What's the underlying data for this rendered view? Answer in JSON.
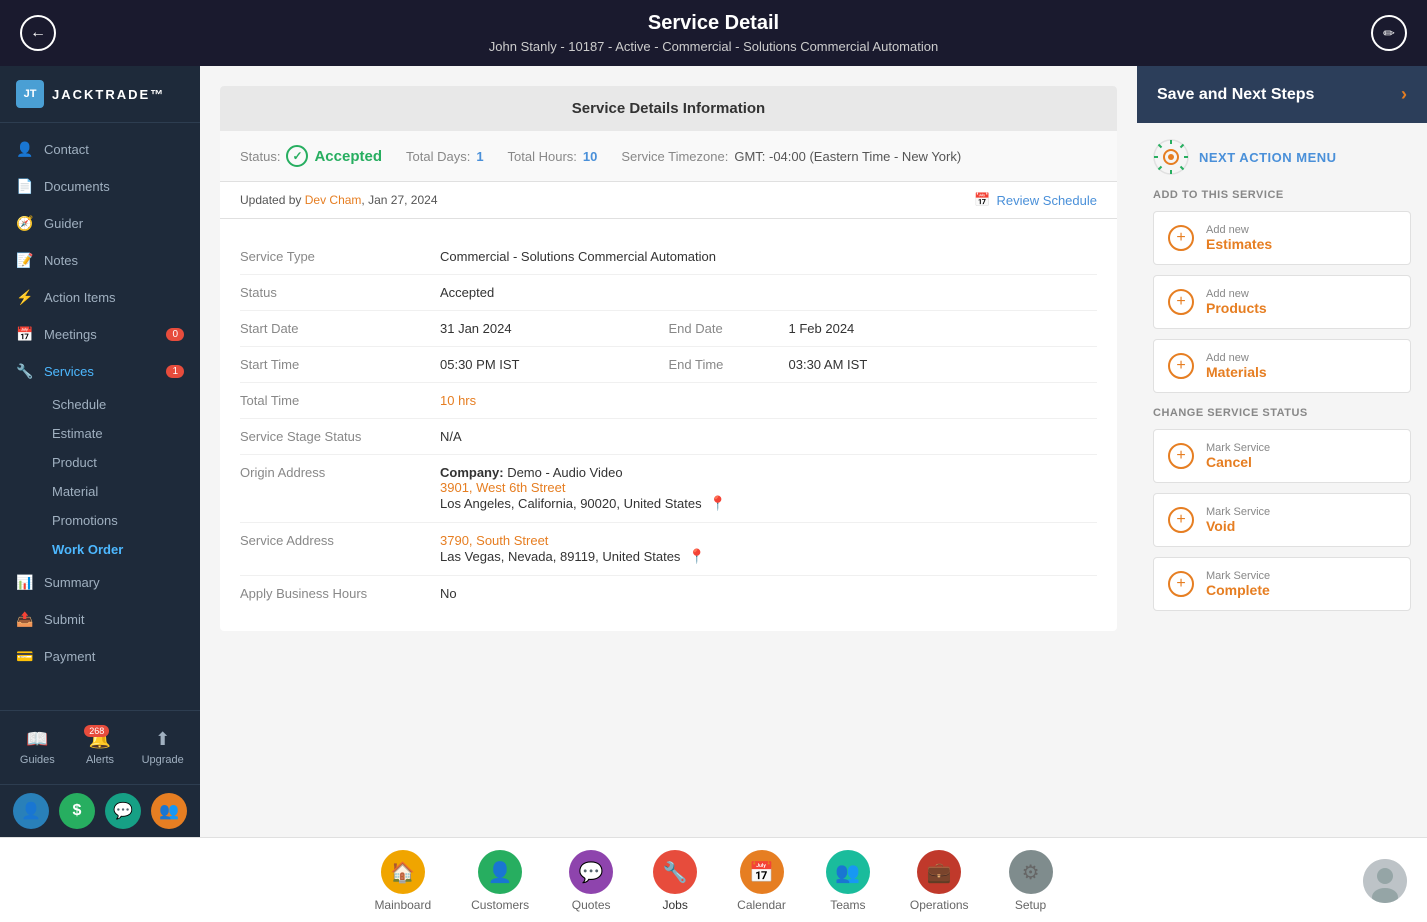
{
  "header": {
    "title": "Service Detail",
    "subtitle": "John Stanly - 10187 - Active - Commercial - Solutions Commercial Automation",
    "back_label": "←",
    "edit_label": "✏"
  },
  "sidebar": {
    "logo": "JT",
    "logo_text": "JACKTRADE™",
    "items": [
      {
        "id": "contact",
        "label": "Contact",
        "icon": "👤",
        "badge": null
      },
      {
        "id": "documents",
        "label": "Documents",
        "icon": "📄",
        "badge": null
      },
      {
        "id": "guider",
        "label": "Guider",
        "icon": "🧭",
        "badge": null
      },
      {
        "id": "notes",
        "label": "Notes",
        "icon": "📝",
        "badge": null
      },
      {
        "id": "action-items",
        "label": "Action Items",
        "icon": "⚡",
        "badge": null
      },
      {
        "id": "meetings",
        "label": "Meetings",
        "icon": "📅",
        "badge": "0"
      },
      {
        "id": "services",
        "label": "Services",
        "icon": "🔧",
        "badge": "1"
      }
    ],
    "sub_items": [
      {
        "id": "schedule",
        "label": "Schedule",
        "active": false
      },
      {
        "id": "estimate",
        "label": "Estimate",
        "active": false
      },
      {
        "id": "product",
        "label": "Product",
        "active": false
      },
      {
        "id": "material",
        "label": "Material",
        "active": false
      },
      {
        "id": "promotions",
        "label": "Promotions",
        "active": false
      },
      {
        "id": "work-order",
        "label": "Work Order",
        "active": true
      }
    ],
    "lower_items": [
      {
        "id": "summary",
        "label": "Summary",
        "icon": "📊"
      },
      {
        "id": "submit",
        "label": "Submit",
        "icon": "📤"
      },
      {
        "id": "payment",
        "label": "Payment",
        "icon": "💳"
      }
    ],
    "footer_buttons": [
      {
        "id": "guides",
        "label": "Guides",
        "icon": "📖",
        "badge": null
      },
      {
        "id": "alerts",
        "label": "Alerts",
        "icon": "🔔",
        "badge": "268"
      },
      {
        "id": "upgrade",
        "label": "Upgrade",
        "icon": "⬆",
        "badge": null
      }
    ],
    "bottom_icons": [
      {
        "id": "person-icon",
        "color": "blue-dark",
        "icon": "👤"
      },
      {
        "id": "dollar-icon",
        "color": "green-dark",
        "icon": "$"
      },
      {
        "id": "chat-icon",
        "color": "teal-dark",
        "icon": "💬"
      },
      {
        "id": "group-icon",
        "color": "orange-dark",
        "icon": "👥"
      }
    ]
  },
  "service_details": {
    "card_title": "Service Details Information",
    "status_label": "Status:",
    "status_value": "Accepted",
    "total_days_label": "Total Days:",
    "total_days_value": "1",
    "total_hours_label": "Total Hours:",
    "total_hours_value": "10",
    "timezone_label": "Service Timezone:",
    "timezone_value": "GMT: -04:00 (Eastern Time - New York)",
    "updated_by_prefix": "Updated by",
    "updated_by_name": "Dev Cham",
    "updated_date": "Jan 27, 2024",
    "review_schedule": "Review Schedule",
    "fields": [
      {
        "label": "Service Type",
        "value": "Commercial - Solutions Commercial Automation",
        "type": "normal"
      },
      {
        "label": "Status",
        "value": "Accepted",
        "type": "normal"
      },
      {
        "label": "Start Date",
        "value": "31 Jan 2024",
        "end_label": "End Date",
        "end_value": "1 Feb 2024",
        "type": "split"
      },
      {
        "label": "Start Time",
        "value": "05:30 PM IST",
        "end_label": "End Time",
        "end_value": "03:30 AM IST",
        "type": "split"
      },
      {
        "label": "Total Time",
        "value": "10 hrs",
        "type": "highlight"
      },
      {
        "label": "Service Stage Status",
        "value": "N/A",
        "type": "normal"
      },
      {
        "label": "Origin Address",
        "company": "Demo - Audio Video",
        "address1": "3901, West 6th Street",
        "address2": "Los Angeles, California, 90020, United States",
        "type": "address"
      },
      {
        "label": "Service Address",
        "address1": "3790, South Street",
        "address2": "Las Vegas, Nevada, 89119, United States",
        "type": "service_address"
      },
      {
        "label": "Apply Business Hours",
        "value": "No",
        "type": "normal"
      }
    ]
  },
  "right_panel": {
    "save_next_label": "Save and Next Steps",
    "chevron": "›",
    "next_action_title": "NEXT ACTION MENU",
    "add_section_title": "ADD TO THIS SERVICE",
    "add_items": [
      {
        "sub": "Add new",
        "main": "Estimates"
      },
      {
        "sub": "Add new",
        "main": "Products"
      },
      {
        "sub": "Add new",
        "main": "Materials"
      }
    ],
    "change_status_title": "CHANGE SERVICE STATUS",
    "status_items": [
      {
        "sub": "Mark Service",
        "main": "Cancel"
      },
      {
        "sub": "Mark Service",
        "main": "Void"
      },
      {
        "sub": "Mark Service",
        "main": "Complete"
      }
    ]
  },
  "bottom_nav": {
    "items": [
      {
        "id": "mainboard",
        "label": "Mainboard",
        "icon": "🏠",
        "color": "yellow",
        "active": false
      },
      {
        "id": "customers",
        "label": "Customers",
        "icon": "👤",
        "color": "green",
        "active": false
      },
      {
        "id": "quotes",
        "label": "Quotes",
        "icon": "💬",
        "color": "purple",
        "active": false
      },
      {
        "id": "jobs",
        "label": "Jobs",
        "icon": "🔧",
        "color": "red",
        "active": true
      },
      {
        "id": "calendar",
        "label": "Calendar",
        "icon": "📅",
        "color": "orange",
        "active": false
      },
      {
        "id": "teams",
        "label": "Teams",
        "icon": "👥",
        "color": "teal",
        "active": false
      },
      {
        "id": "operations",
        "label": "Operations",
        "icon": "💼",
        "color": "dark-red",
        "active": false
      },
      {
        "id": "setup",
        "label": "Setup",
        "icon": "⚙",
        "color": "gray",
        "active": false
      }
    ]
  }
}
